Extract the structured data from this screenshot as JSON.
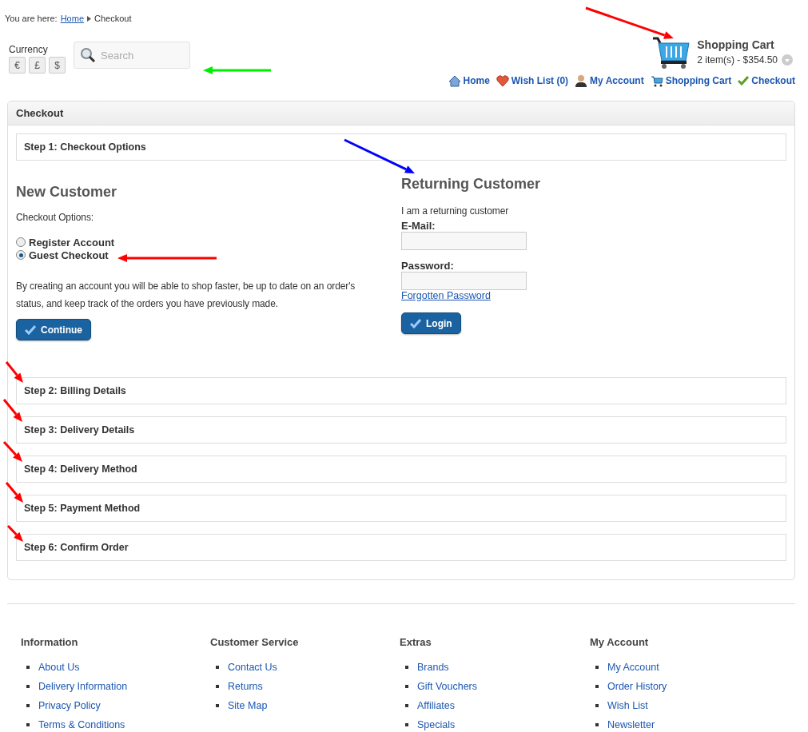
{
  "breadcrumb": {
    "label": "You are here:",
    "items": [
      {
        "text": "Home",
        "kind": "link"
      },
      {
        "text": "Checkout",
        "kind": "current"
      }
    ]
  },
  "currency": {
    "label": "Currency",
    "options": [
      "€",
      "£",
      "$"
    ]
  },
  "search": {
    "placeholder": "Search"
  },
  "cart": {
    "title": "Shopping Cart",
    "summary": "2 item(s) - $354.50"
  },
  "top_links": [
    {
      "text": "Home",
      "kind": "home"
    },
    {
      "text": "Wish List (0)",
      "kind": "heart"
    },
    {
      "text": "My Account",
      "kind": "person"
    },
    {
      "text": "Shopping Cart",
      "kind": "cart"
    },
    {
      "text": "Checkout",
      "kind": "check"
    }
  ],
  "checkout": {
    "title": "Checkout",
    "steps": [
      {
        "title": "Step 1: Checkout Options",
        "new_customer": {
          "heading": "New Customer",
          "options_label": "Checkout Options:",
          "options": [
            {
              "label": "Register Account",
              "selected": false
            },
            {
              "label": "Guest Checkout",
              "selected": true
            }
          ],
          "description": "By creating an account you will be able to shop faster, be up to date on an order's status, and keep track of the orders you have previously made.",
          "button": "Continue"
        },
        "returning_customer": {
          "heading": "Returning Customer",
          "intro": "I am a returning customer",
          "fields": [
            {
              "label": "E-Mail:"
            },
            {
              "label": "Password:"
            }
          ],
          "forgot_link": "Forgotten Password",
          "button": "Login"
        }
      },
      {
        "title": "Step 2: Billing Details"
      },
      {
        "title": "Step 3: Delivery Details"
      },
      {
        "title": "Step 4: Delivery Method"
      },
      {
        "title": "Step 5: Payment Method"
      },
      {
        "title": "Step 6: Confirm Order"
      }
    ]
  },
  "footer": [
    {
      "heading": "Information",
      "links": [
        "About Us",
        "Delivery Information",
        "Privacy Policy",
        "Terms & Conditions"
      ]
    },
    {
      "heading": "Customer Service",
      "links": [
        "Contact Us",
        "Returns",
        "Site Map"
      ]
    },
    {
      "heading": "Extras",
      "links": [
        "Brands",
        "Gift Vouchers",
        "Affiliates",
        "Specials"
      ]
    },
    {
      "heading": "My Account",
      "links": [
        "My Account",
        "Order History",
        "Wish List",
        "Newsletter"
      ]
    }
  ]
}
